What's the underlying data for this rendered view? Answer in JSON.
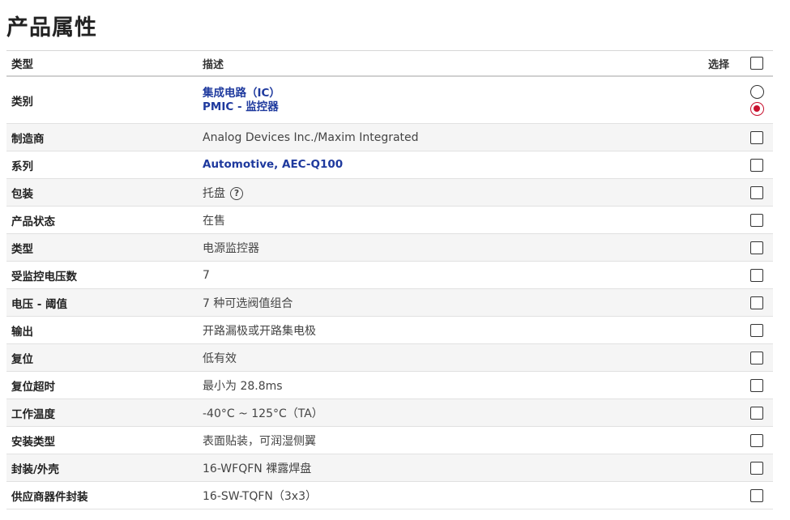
{
  "page_title": "产品属性",
  "header": {
    "type": "类型",
    "description": "描述",
    "select": "选择"
  },
  "rows": [
    {
      "type": "类别",
      "links": [
        "集成电路（IC）",
        "PMIC - 监控器"
      ]
    },
    {
      "type": "制造商",
      "value": "Analog Devices Inc./Maxim Integrated"
    },
    {
      "type": "系列",
      "link": "Automotive, AEC-Q100"
    },
    {
      "type": "包装",
      "value": "托盘",
      "help_icon": "question-circle-icon",
      "help_glyph": "?"
    },
    {
      "type": "产品状态",
      "value": "在售"
    },
    {
      "type": "类型",
      "value": "电源监控器"
    },
    {
      "type": "受监控电压数",
      "value": "7"
    },
    {
      "type": "电压 - 阈值",
      "value": "7 种可选阀值组合"
    },
    {
      "type": "输出",
      "value": "开路漏极或开路集电极"
    },
    {
      "type": "复位",
      "value": "低有效"
    },
    {
      "type": "复位超时",
      "value": "最小为 28.8ms"
    },
    {
      "type": "工作温度",
      "value": "-40°C ~ 125°C（TA）"
    },
    {
      "type": "安装类型",
      "value": "表面贴装，可润湿侧翼"
    },
    {
      "type": "封装/外壳",
      "value": "16-WFQFN 裸露焊盘"
    },
    {
      "type": "供应商器件封装",
      "value": "16-SW-TQFN（3x3）"
    }
  ],
  "category_selection": [
    "unselected",
    "selected"
  ],
  "colors": {
    "link": "#1f3a9e",
    "radio_selected": "#c8102e",
    "stripe": "#f5f5f5"
  }
}
